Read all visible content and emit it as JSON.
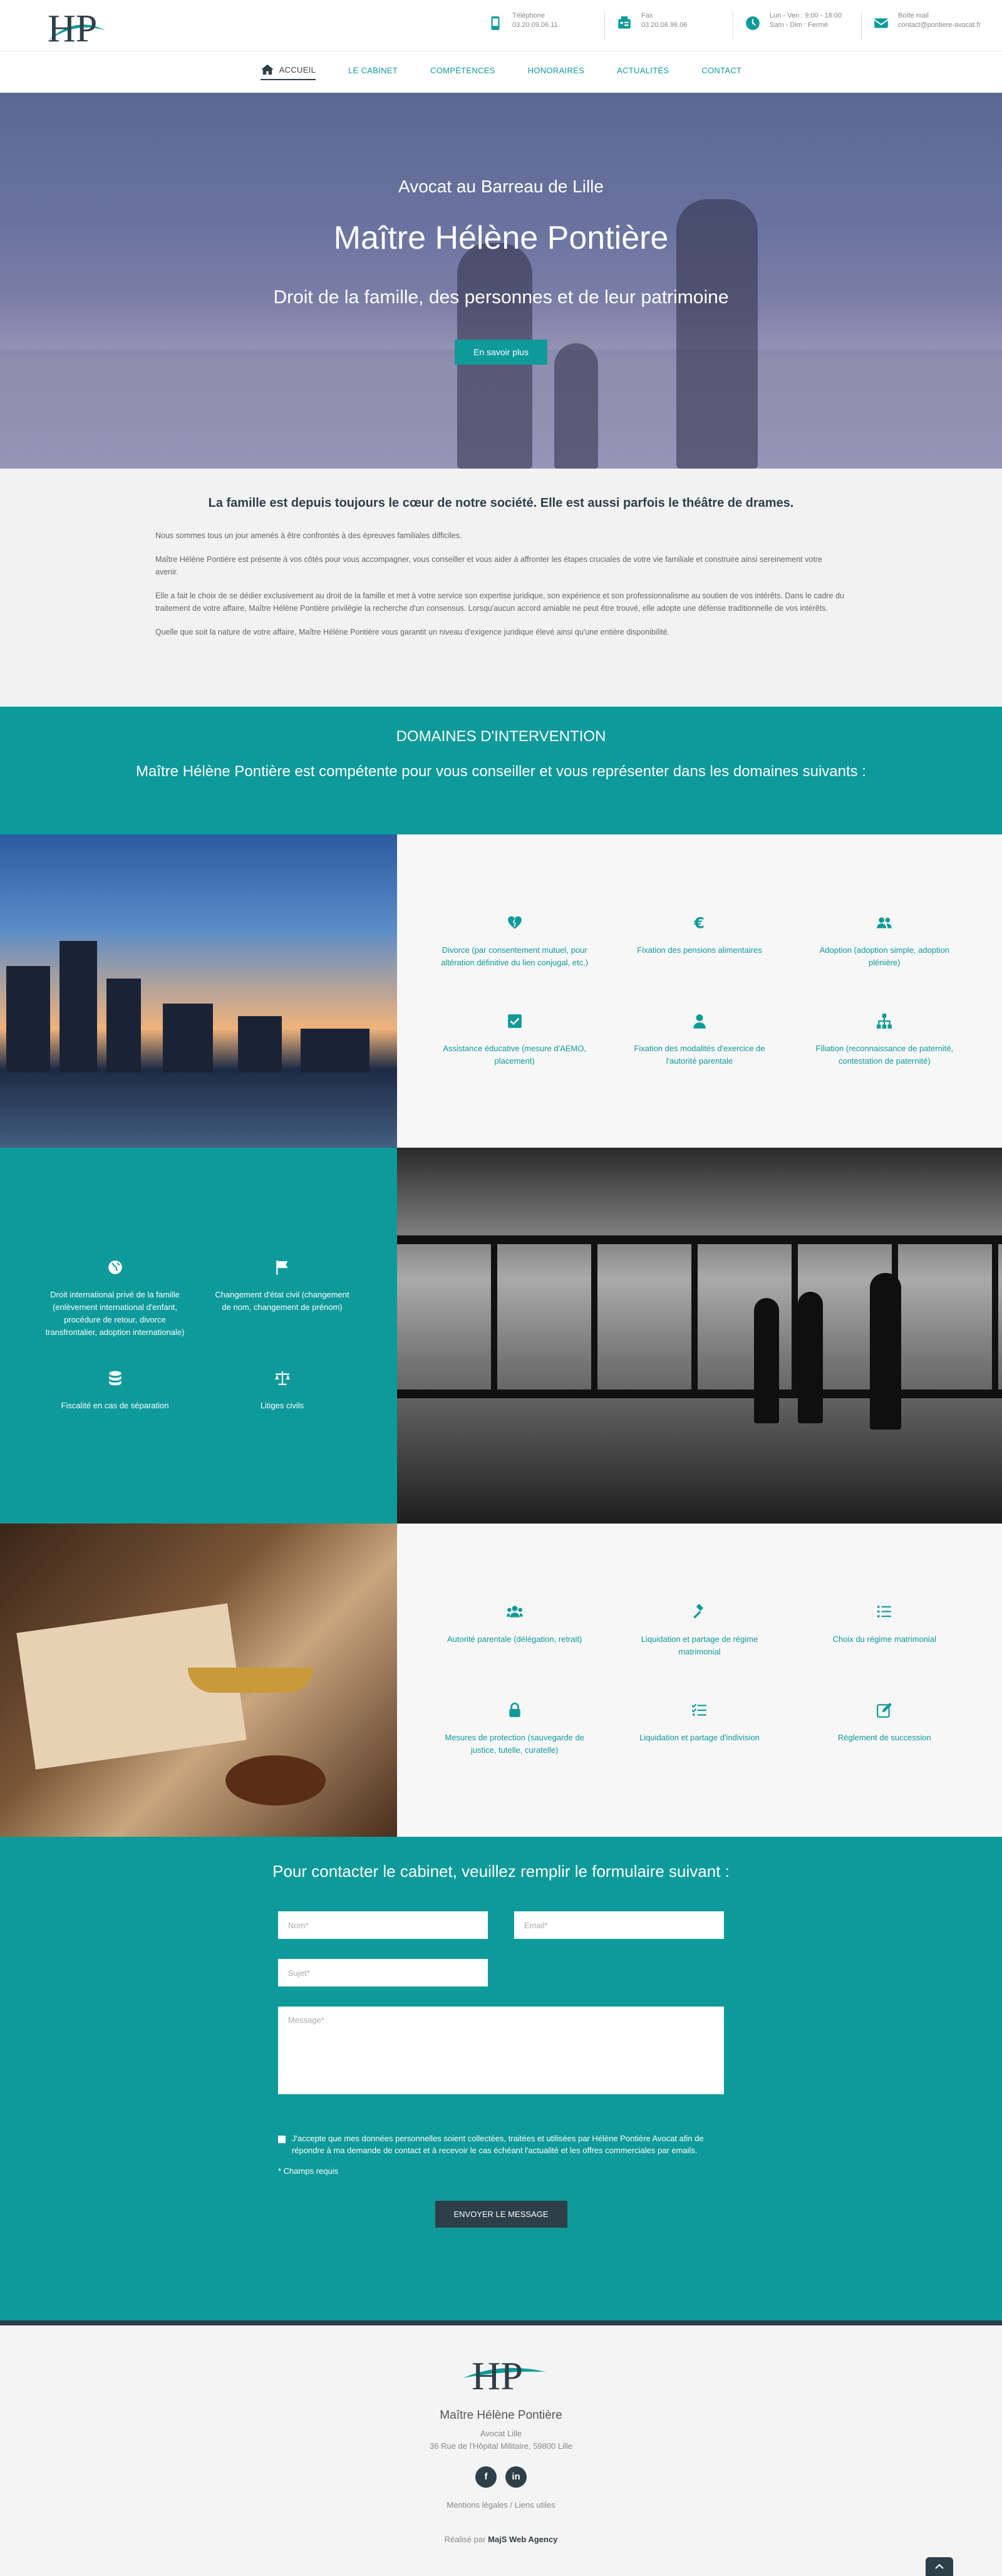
{
  "header": {
    "contacts": [
      {
        "icon": "phone-icon",
        "label": "Téléphone",
        "value": "03.20.09.06.11"
      },
      {
        "icon": "fax-icon",
        "label": "Fax",
        "value": "03.20.06.96.06"
      },
      {
        "icon": "clock-icon",
        "label": "Lun - Ven : 9:00 - 18:00",
        "value": "Sam - Dim : Fermé"
      },
      {
        "icon": "mail-icon",
        "label": "Boîte mail",
        "value": "contact@pontiere-avocat.fr"
      }
    ]
  },
  "nav": {
    "items": [
      {
        "label": "ACCUEIL"
      },
      {
        "label": "LE CABINET"
      },
      {
        "label": "COMPÉTENCES"
      },
      {
        "label": "HONORAIRES"
      },
      {
        "label": "ACTUALITÉS"
      },
      {
        "label": "CONTACT"
      }
    ]
  },
  "hero": {
    "subtitle": "Avocat au Barreau de Lille",
    "title": "Maître Hélène Pontière",
    "tagline": "Droit de la famille, des personnes et de leur patrimoine",
    "button": "En savoir plus"
  },
  "intro": {
    "heading": "La famille est depuis toujours le cœur de notre société. Elle est aussi parfois le théâtre de drames.",
    "p1": "Nous sommes tous un jour amenés à être confrontés à des épreuves familiales difficiles.",
    "p2": "Maître Hélène Pontière est présente à vos côtés pour vous accompagner, vous conseiller et vous aider à affronter les étapes cruciales de votre vie familiale et construire ainsi sereinement votre avenir.",
    "p3": "Elle a fait le choix de se dédier exclusivement au droit de la famille et met à votre service son expertise juridique, son expérience et son professionnalisme au soutien de vos intérêts. Dans le cadre du traitement de votre affaire, Maître Hélène Pontière privilégie la recherche d'un consensus. Lorsqu'aucun accord amiable ne peut être trouvé, elle adopte une défense traditionnelle de vos intérêts.",
    "p4": "Quelle que soit la nature de votre affaire, Maître Hélène Pontière vous garantit un niveau d'exigence juridique élevé ainsi qu'une entière disponibilité."
  },
  "domains": {
    "title": "DOMAINES D'INTERVENTION",
    "lead": "Maître Hélène Pontière est compétente pour vous conseiller et vous représenter dans les domaines suivants :",
    "group1": [
      {
        "icon": "broken-heart-icon",
        "label": "Divorce (par consentement mutuel, pour altération définitive du lien conjugal, etc.)"
      },
      {
        "icon": "euro-icon",
        "label": "Fixation des pensions alimentaires"
      },
      {
        "icon": "users-icon",
        "label": "Adoption (adoption simple, adoption plénière)"
      },
      {
        "icon": "check-square-icon",
        "label": "Assistance éducative (mesure d'AEMO, placement)"
      },
      {
        "icon": "user-icon",
        "label": "Fixation des modalités d'exercice de l'autorité parentale"
      },
      {
        "icon": "sitemap-icon",
        "label": "Filiation (reconnaissance de paternité, contestation de paternité)"
      }
    ],
    "group2": [
      {
        "icon": "globe-icon",
        "label": "Droit international privé de la famille (enlèvement international d'enfant, procédure de retour, divorce transfrontalier, adoption internationale)"
      },
      {
        "icon": "flag-icon",
        "label": "Changement d'état civil (changement de nom, changement de prénom)"
      },
      {
        "icon": "coins-icon",
        "label": "Fiscalité en cas de séparation"
      },
      {
        "icon": "balance-scale-icon",
        "label": "Litiges civils"
      }
    ],
    "group3": [
      {
        "icon": "users-cog-icon",
        "label": "Autorité parentale (délégation, retrait)"
      },
      {
        "icon": "gavel-icon",
        "label": "Liquidation et partage de régime matrimonial"
      },
      {
        "icon": "list-icon",
        "label": "Choix du régime matrimonial"
      },
      {
        "icon": "lock-icon",
        "label": "Mesures de protection (sauvegarde de justice, tutelle, curatelle)"
      },
      {
        "icon": "tasks-icon",
        "label": "Liquidation et partage d'indivision"
      },
      {
        "icon": "edit-icon",
        "label": "Règlement de succession"
      }
    ]
  },
  "form": {
    "title": "Pour contacter le cabinet, veuillez remplir le formulaire suivant :",
    "name_placeholder": "Nom*",
    "email_placeholder": "Email*",
    "subject_placeholder": "Sujet*",
    "message_placeholder": "Message*",
    "consent": "J'accepte que mes données personnelles soient collectées, traitées et utilisées par Hélène Pontière Avocat afin de répondre à ma demande de contact et à recevoir le cas échéant l'actualité et les offres commerciales par emails.",
    "required": "* Champs requis",
    "submit": "ENVOYER LE MESSAGE"
  },
  "footer": {
    "name": "Maître Hélène Pontière",
    "role": "Avocat Lille",
    "address": "36 Rue de l'Hôpital Militaire, 59800 Lille",
    "social": [
      {
        "icon": "facebook-icon",
        "glyph": "f"
      },
      {
        "icon": "linkedin-icon",
        "glyph": "in"
      }
    ],
    "links": "Mentions légales / Liens utiles",
    "credit_prefix": "Réalisé par",
    "credit_agency": "MajS Web Agency"
  },
  "colors": {
    "accent": "#0e9a9a",
    "dark": "#2d3f48"
  }
}
